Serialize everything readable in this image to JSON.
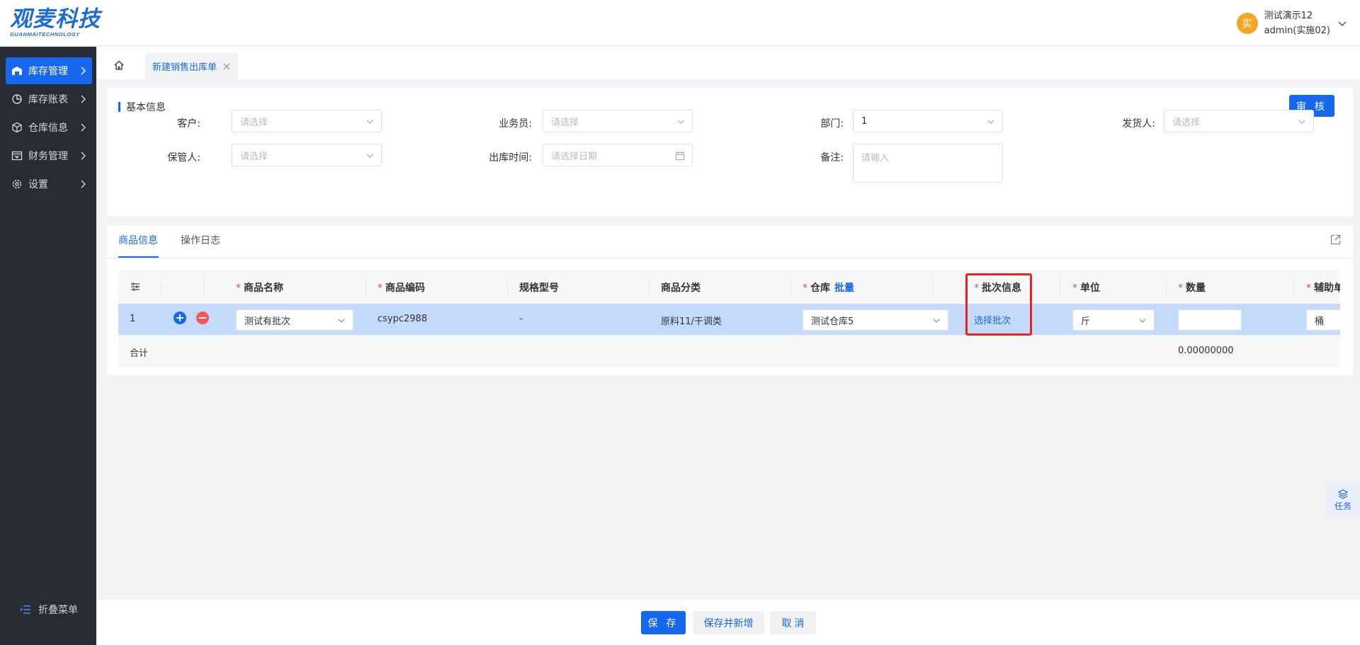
{
  "brand": {
    "name": "观麦科技",
    "sub": "GUANMAITECHNOLOGY"
  },
  "user": {
    "avatar_char": "实",
    "name": "测试演示12",
    "account": "admin(实施02)"
  },
  "sidebar": {
    "items": [
      {
        "label": "库存管理",
        "icon": "warehouse-icon",
        "active": true
      },
      {
        "label": "库存账表",
        "icon": "chart-pie-icon",
        "active": false
      },
      {
        "label": "仓库信息",
        "icon": "box-icon",
        "active": false
      },
      {
        "label": "财务管理",
        "icon": "finance-icon",
        "active": false
      },
      {
        "label": "设置",
        "icon": "gear-icon",
        "active": false
      }
    ],
    "collapse_label": "折叠菜单"
  },
  "tabs": {
    "current": "新建销售出库单"
  },
  "basic": {
    "title": "基本信息",
    "audit_label": "审 核",
    "customer": {
      "label": "客户:",
      "placeholder": "请选择"
    },
    "salesman": {
      "label": "业务员:",
      "placeholder": "请选择"
    },
    "department": {
      "label": "部门:",
      "value": "1"
    },
    "shipper": {
      "label": "发货人:",
      "placeholder": "请选择"
    },
    "keeper": {
      "label": "保管人:",
      "placeholder": "请选择"
    },
    "out_time": {
      "label": "出库时间:",
      "placeholder": "请选择日期"
    },
    "remark": {
      "label": "备注:",
      "placeholder": "请输入"
    }
  },
  "goods": {
    "tabs": [
      "商品信息",
      "操作日志"
    ],
    "columns": {
      "name": "商品名称",
      "code": "商品编码",
      "spec": "规格型号",
      "category": "商品分类",
      "warehouse": "仓库",
      "warehouse_batch": "批量",
      "batch": "批次信息",
      "unit": "单位",
      "qty": "数量",
      "aux_unit": "辅助单"
    },
    "row": {
      "index": "1",
      "name": "测试有批次",
      "code": "csypc2988",
      "spec": "-",
      "category": "原料11/干调类",
      "warehouse": "测试仓库5",
      "batch_link": "选择批次",
      "unit": "斤",
      "qty": "",
      "aux_unit": "桶"
    },
    "total_label": "合计",
    "total_qty": "0.00000000"
  },
  "task_float_label": "任务",
  "footer": {
    "save": "保 存",
    "save_new": "保存并新增",
    "cancel": "取 消"
  },
  "colors": {
    "primary": "#1768f0",
    "sidebar_bg": "#282c34",
    "row_selected": "#c4dafa",
    "highlight": "#e52323"
  }
}
